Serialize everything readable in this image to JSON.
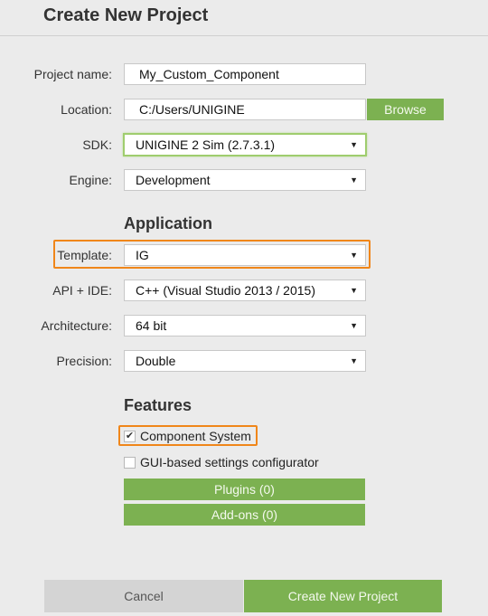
{
  "dialog": {
    "title": "Create New Project"
  },
  "form": {
    "project_name": {
      "label": "Project name:",
      "value": "My_Custom_Component"
    },
    "location": {
      "label": "Location:",
      "value": "C:/Users/UNIGINE",
      "browse_label": "Browse"
    },
    "sdk": {
      "label": "SDK:",
      "value": "UNIGINE 2 Sim (2.7.3.1)",
      "icon": "dropdown-arrow-icon"
    },
    "engine": {
      "label": "Engine:",
      "value": "Development",
      "icon": "dropdown-arrow-icon"
    }
  },
  "application": {
    "heading": "Application",
    "template": {
      "label": "Template:",
      "value": "IG"
    },
    "api_ide": {
      "label": "API + IDE:",
      "value": "C++ (Visual Studio 2013 / 2015)"
    },
    "architecture": {
      "label": "Architecture:",
      "value": "64 bit"
    },
    "precision": {
      "label": "Precision:",
      "value": "Double"
    }
  },
  "features": {
    "heading": "Features",
    "component_system": {
      "label": "Component System",
      "checked": true,
      "check_glyph": "✔"
    },
    "gui_configurator": {
      "label": "GUI-based settings configurator",
      "checked": false
    },
    "plugins_label": "Plugins (0)",
    "addons_label": "Add-ons (0)"
  },
  "footer": {
    "cancel_label": "Cancel",
    "create_label": "Create New Project"
  },
  "dropdown_arrow": "▼",
  "colors": {
    "accent_green": "#7cb151",
    "highlight_orange": "#f0861a",
    "focus_green": "#9fcd6e",
    "background": "#ebebeb"
  }
}
